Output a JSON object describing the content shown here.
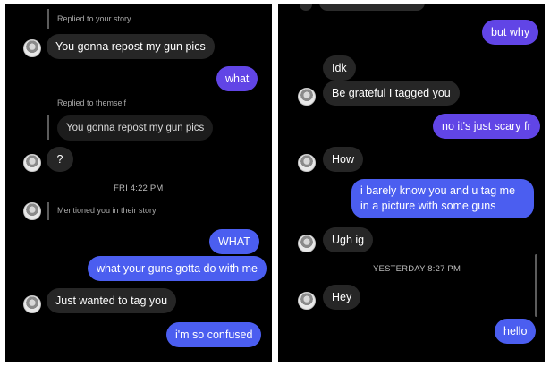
{
  "left": {
    "replied_story": "Replied to your story",
    "msg_repost": "You gonna repost my gun pics",
    "msg_what": "what",
    "replied_themself": "Replied to themself",
    "quoted_repost": "You gonna repost my gun pics",
    "msg_question": "?",
    "timestamp": "FRI 4:22 PM",
    "mentioned": "Mentioned you in their story",
    "msg_WHAT": "WHAT",
    "msg_guns": "what your guns gotta do with me",
    "msg_tag": "Just wanted to tag you",
    "msg_confused": "i'm so confused"
  },
  "right": {
    "msg_but_why": "but why",
    "msg_idk": "Idk",
    "msg_grateful": "Be grateful I tagged you",
    "msg_scary": "no it's just scary fr",
    "msg_how": "How",
    "msg_barely": "i barely know you and u tag me in a picture with some guns",
    "msg_ugh": "Ugh ig",
    "timestamp": "YESTERDAY 8:27 PM",
    "msg_hey": "Hey",
    "msg_hello": "hello"
  },
  "colors": {
    "background": "#000000",
    "incoming_bubble": "#262626",
    "outgoing_bubble": "#6145e6"
  }
}
